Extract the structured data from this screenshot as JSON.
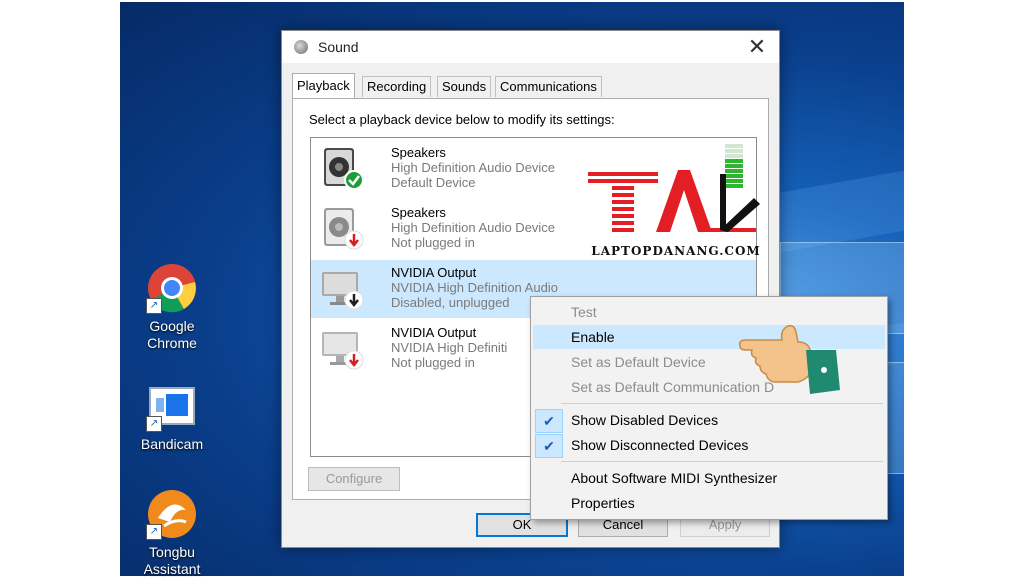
{
  "desktop": {
    "icons": [
      {
        "name": "google-chrome",
        "label_lines": [
          "Google",
          "Chrome"
        ]
      },
      {
        "name": "bandicam",
        "label_lines": [
          "Bandicam"
        ]
      },
      {
        "name": "tongbu-assistant",
        "label_lines": [
          "Tongbu",
          "Assistant"
        ]
      }
    ]
  },
  "dialog": {
    "title": "Sound",
    "close_glyph": "✕",
    "tabs": [
      "Playback",
      "Recording",
      "Sounds",
      "Communications"
    ],
    "active_tab": "Playback",
    "instruction": "Select a playback device below to modify its settings:",
    "devices": [
      {
        "name": "Speakers",
        "line1": "High Definition Audio Device",
        "line2": "Default Device",
        "icon": "speaker-icon",
        "status_icon": "default-check-icon",
        "status_color": "#1e9e3a",
        "selected": false
      },
      {
        "name": "Speakers",
        "line1": "High Definition Audio Device",
        "line2": "Not plugged in",
        "icon": "speaker-icon",
        "status_icon": "unplugged-arrow-icon",
        "status_color": "#d32020",
        "selected": false
      },
      {
        "name": "NVIDIA Output",
        "line1": "NVIDIA High Definition Audio",
        "line2": "Disabled, unplugged",
        "icon": "monitor-icon",
        "status_icon": "disabled-arrow-icon",
        "status_color": "#202020",
        "selected": true
      },
      {
        "name": "NVIDIA Output",
        "line1": "NVIDIA High Definiti",
        "line2": "Not plugged in",
        "icon": "monitor-icon",
        "status_icon": "unplugged-arrow-icon",
        "status_color": "#d32020",
        "selected": false
      }
    ],
    "configure_label": "Configure",
    "buttons": {
      "ok": "OK",
      "cancel": "Cancel",
      "apply": "Apply"
    }
  },
  "context_menu": {
    "items": [
      {
        "label": "Test",
        "disabled": true,
        "checked": false,
        "hover": false
      },
      {
        "label": "Enable",
        "disabled": false,
        "checked": false,
        "hover": true
      },
      {
        "label": "Set as Default Device",
        "disabled": true,
        "checked": false,
        "hover": false
      },
      {
        "label": "Set as Default Communication D",
        "disabled": true,
        "checked": false,
        "hover": false
      },
      {
        "label": "Show Disabled Devices",
        "disabled": false,
        "checked": true,
        "hover": false
      },
      {
        "label": "Show Disconnected Devices",
        "disabled": false,
        "checked": true,
        "hover": false
      },
      {
        "label": "About Software MIDI Synthesizer",
        "disabled": false,
        "checked": false,
        "hover": false
      },
      {
        "label": "Properties",
        "disabled": false,
        "checked": false,
        "hover": false
      }
    ]
  },
  "watermark": {
    "text": "LAPTOPDANANG.COM",
    "color": "#e31e24"
  },
  "colors": {
    "selection": "#cce8ff",
    "accent": "#0078d7",
    "meter_on": "#2fb52f",
    "meter_off": "#cfe8cf"
  }
}
